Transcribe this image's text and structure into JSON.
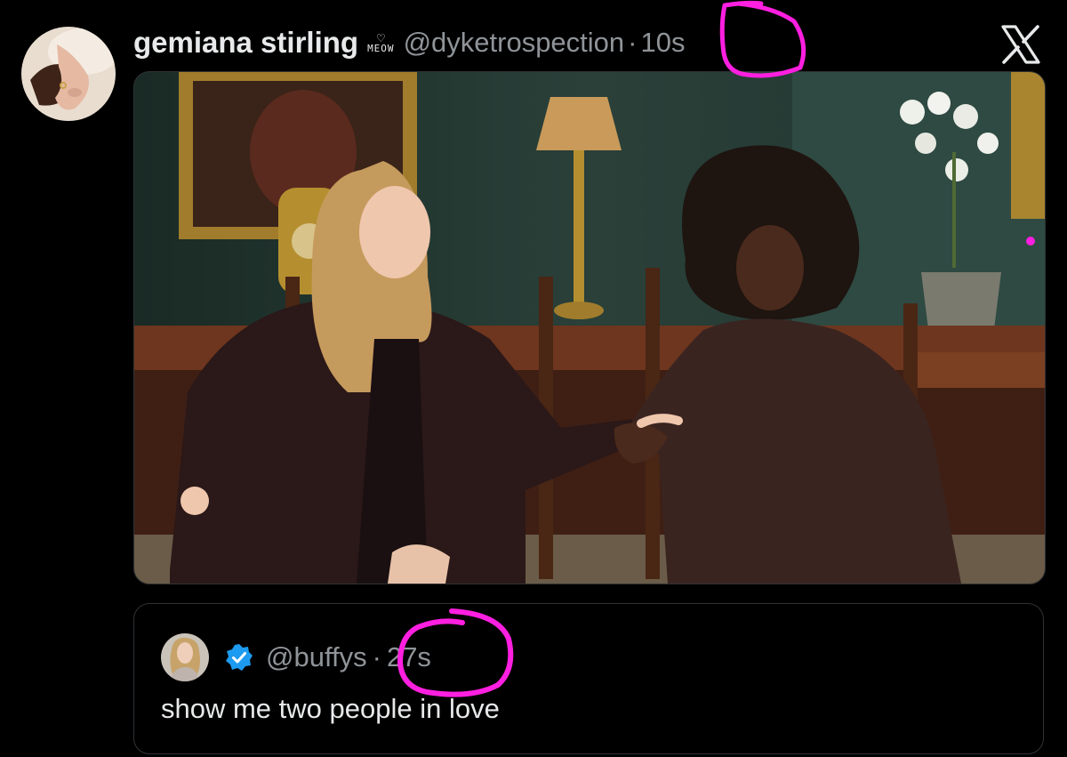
{
  "tweet": {
    "display_name": "gemiana stirling",
    "badge_text": "MEOW",
    "handle": "@dyketrospection",
    "separator": "·",
    "time": "10s",
    "avatar_icon": "hands-avatar",
    "platform_icon": "x-logo-icon"
  },
  "quote_tweet": {
    "handle": "@buffys",
    "separator": "·",
    "time": "27s",
    "text": "show me two people in love",
    "verified": true,
    "verified_color": "#1d9bf0"
  },
  "colors": {
    "background": "#000000",
    "text_primary": "#e7e9ea",
    "text_secondary": "#8f9499",
    "border": "#2f3336",
    "annotation": "#ff1fe0"
  }
}
